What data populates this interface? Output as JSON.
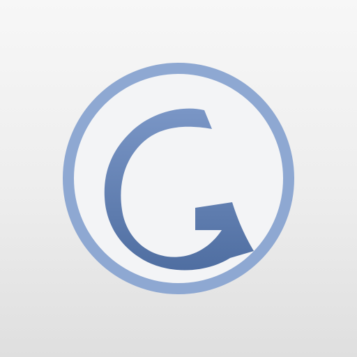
{
  "logo": {
    "letter": "G",
    "ring_color": "#8fa9d3",
    "disc_color": "#f3f4f6",
    "letter_color_light": "#7492c3",
    "letter_color_dark": "#4f6fa2"
  }
}
